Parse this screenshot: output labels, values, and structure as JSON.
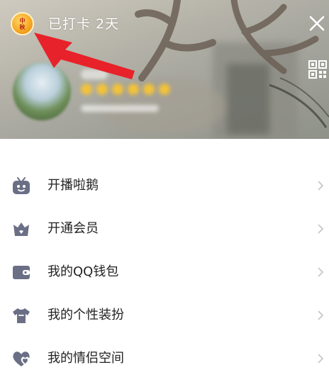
{
  "header": {
    "badge_text": [
      "中",
      "秋"
    ],
    "checkin_text": "已打卡 2天",
    "close_icon": "close-icon",
    "qr_icon": "qr-code-icon"
  },
  "colors": {
    "icon": "#6b6f86",
    "text": "#222222",
    "chevron": "#c7c7cc",
    "annotation_arrow": "#e8222a"
  },
  "menu": {
    "items": [
      {
        "label": "开播啦鹅",
        "icon": "tv-icon"
      },
      {
        "label": "开通会员",
        "icon": "crown-icon"
      },
      {
        "label": "我的QQ钱包",
        "icon": "wallet-icon"
      },
      {
        "label": "我的个性装扮",
        "icon": "tshirt-icon"
      },
      {
        "label": "我的情侣空间",
        "icon": "hearts-icon"
      }
    ]
  }
}
